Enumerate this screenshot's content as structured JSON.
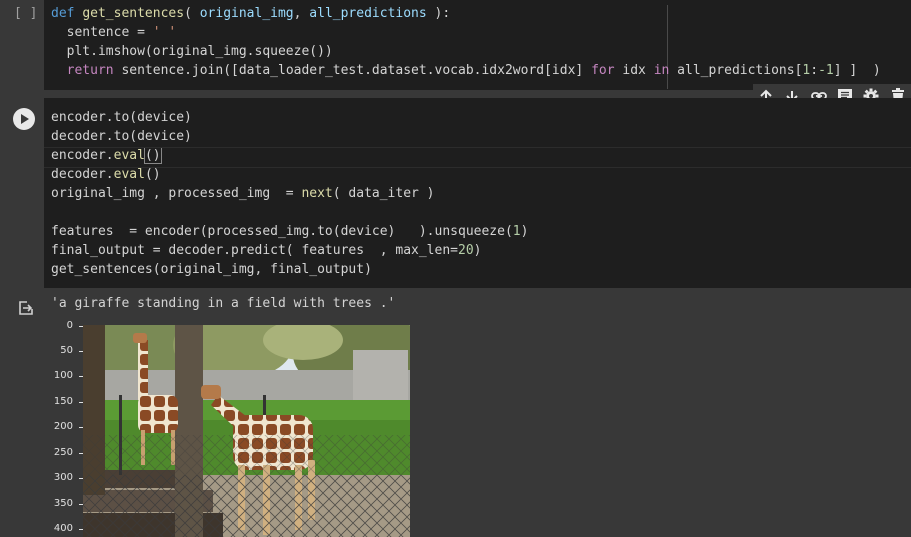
{
  "cell1": {
    "bracket_label": "[ ]",
    "lines": [
      [
        "def ",
        "get_sentences",
        "( ",
        "original_img",
        ", ",
        "all_predictions",
        " ):"
      ],
      [
        "  sentence = ",
        "' '"
      ],
      [
        "  plt.imshow(original_img.squeeze())"
      ],
      [
        "  return ",
        "sentence.join([data_loader_test.dataset.vocab.idx2word[idx] ",
        "for",
        " idx ",
        "in",
        " all_predictions[",
        "1",
        ":",
        "-1",
        "] ]  )"
      ]
    ]
  },
  "toolbar": {
    "icons": [
      "arrow-up-icon",
      "arrow-down-icon",
      "link-icon",
      "comment-icon",
      "gear-icon",
      "trash-icon"
    ]
  },
  "cell2": {
    "lines": [
      [
        "encoder.to(device)"
      ],
      [
        "decoder.to(device)"
      ],
      [
        "encoder.",
        "eval",
        "()"
      ],
      [
        "decoder.",
        "eval",
        "()"
      ],
      [
        "original_img , processed_img  = ",
        "next",
        "( data_iter )"
      ],
      [
        ""
      ],
      [
        "features  = encoder(processed_img.to(device)   ).unsqueeze(",
        "1",
        ")"
      ],
      [
        "final_output = decoder.predict( features  , max_len=",
        "20",
        ")"
      ],
      [
        "get_sentences(original_img, final_output)"
      ]
    ]
  },
  "output": {
    "text": "'a giraffe standing in a field with trees .'",
    "y_ticks": [
      "0",
      "50",
      "100",
      "150",
      "200",
      "250",
      "300",
      "350",
      "400"
    ]
  },
  "colors": {
    "background": "#383838",
    "code_bg": "#1e1e1e",
    "keyword": "#c586c0",
    "builtin_keyword": "#569cd6",
    "function": "#dcdcaa",
    "param": "#9cdcfe",
    "string": "#ce9178",
    "number": "#b5cea8"
  }
}
